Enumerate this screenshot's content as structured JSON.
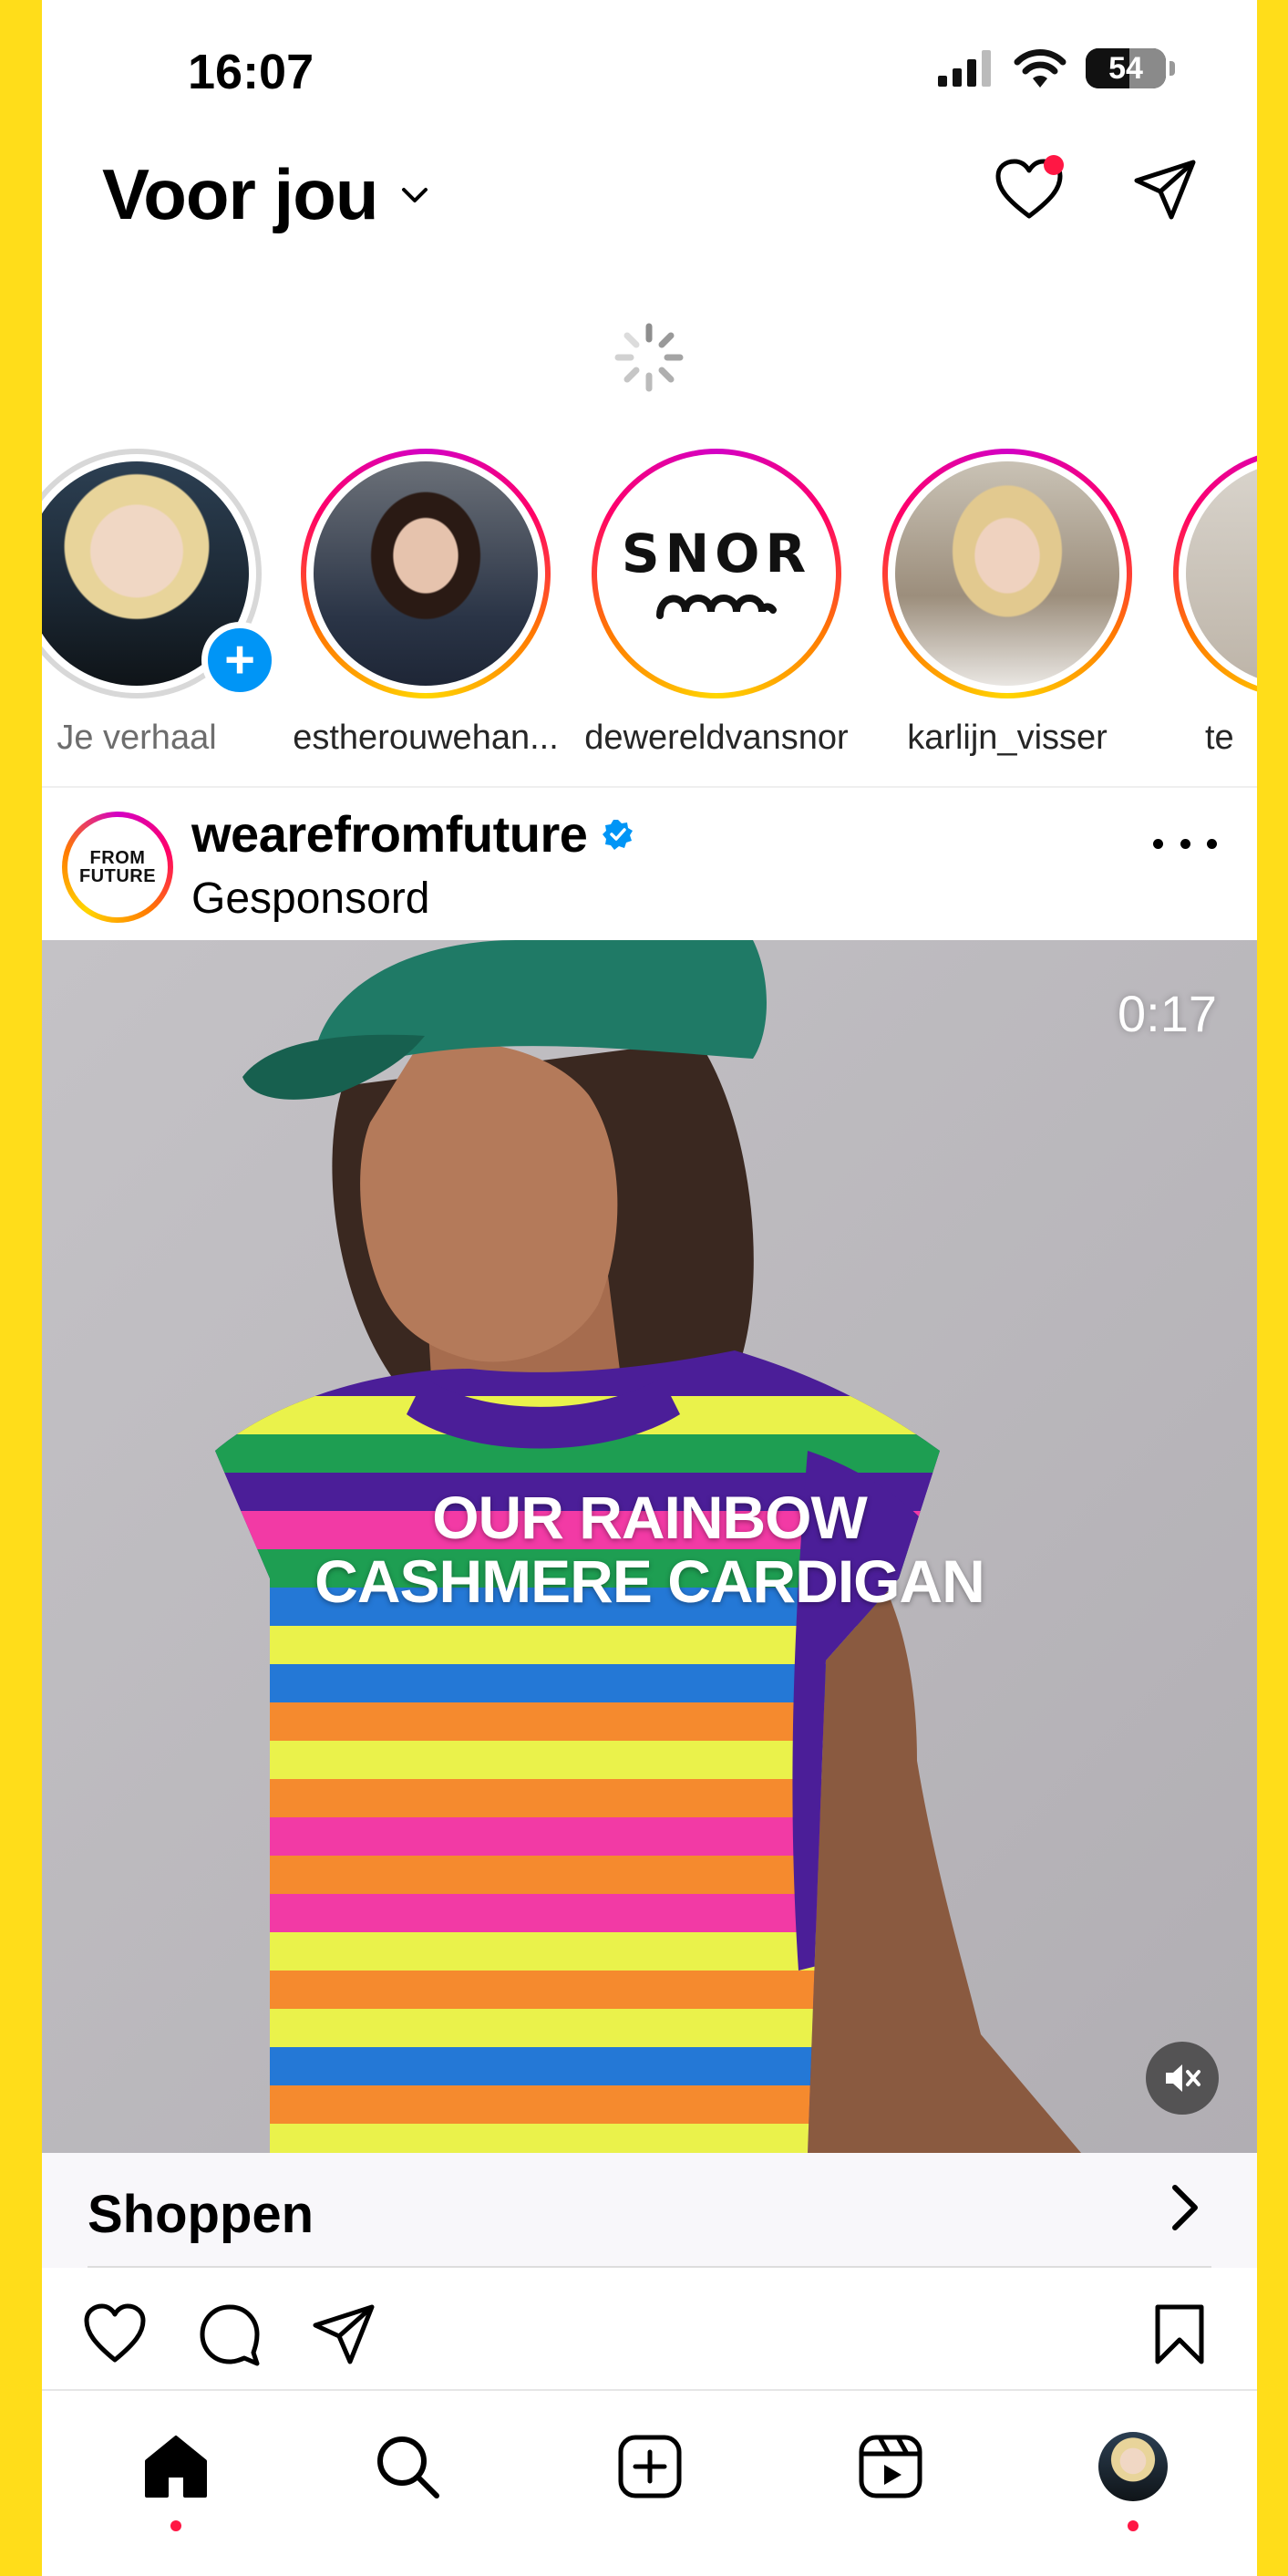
{
  "status_bar": {
    "time": "16:07",
    "battery": "54",
    "battery_level_percent": 54
  },
  "header": {
    "title": "Voor jou",
    "has_notification": true
  },
  "stories": [
    {
      "label": "Je verhaal",
      "is_own": true
    },
    {
      "label": "estherouwehan..."
    },
    {
      "label": "dewereldvansnor",
      "logo_text": "SNOR"
    },
    {
      "label": "karlijn_visser"
    },
    {
      "label": "te"
    }
  ],
  "post": {
    "username": "wearefromfuture",
    "verified": true,
    "subtitle": "Gesponsord",
    "brand_logo_line1": "FROM",
    "brand_logo_line2": "FUTURE",
    "video_time": "0:17",
    "overlay_line1": "OUR RAINBOW",
    "overlay_line2": "CASHMERE CARDIGAN",
    "muted": true,
    "shop_label": "Shoppen"
  },
  "nav": {
    "items": [
      "home-icon",
      "search-icon",
      "create-icon",
      "reels-icon",
      "profile-avatar"
    ],
    "active": "home-icon"
  },
  "colors": {
    "accent_blue": "#0095F6",
    "notification_red": "#FF1744",
    "frame_yellow": "#FFDD1A"
  }
}
